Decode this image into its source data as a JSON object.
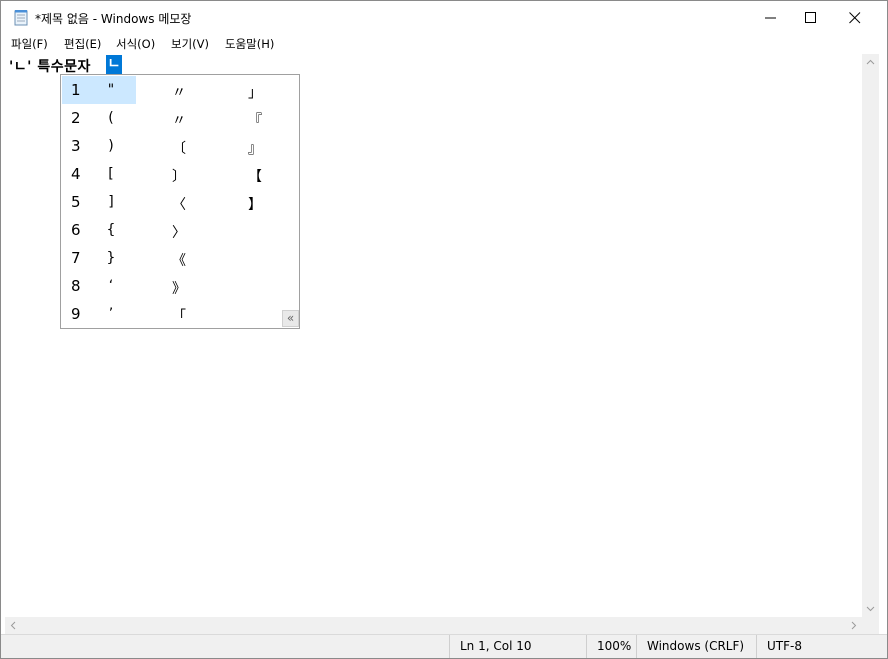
{
  "window": {
    "title": "*제목 없음 - Windows 메모장",
    "controls": {
      "minimize": "minimize-icon",
      "maximize": "maximize-icon",
      "close": "close-icon"
    }
  },
  "menu": {
    "items": [
      {
        "label": "파일(F)"
      },
      {
        "label": "편집(E)"
      },
      {
        "label": "서식(O)"
      },
      {
        "label": "보기(V)"
      },
      {
        "label": "도움말(H)"
      }
    ]
  },
  "editor": {
    "text": "'ㄴ' 특수문자 ",
    "composing_char": "ㄴ",
    "accent_color": "#0078d7"
  },
  "candidates": {
    "selected_index": 1,
    "selected_color": "#cce8ff",
    "rows": [
      {
        "num": "1",
        "c1": "\"",
        "c2": "〃",
        "c3": "」"
      },
      {
        "num": "2",
        "c1": "(",
        "c2": "〃",
        "c3": "『"
      },
      {
        "num": "3",
        "c1": ")",
        "c2": "〔",
        "c3": "』"
      },
      {
        "num": "4",
        "c1": "[",
        "c2": "〕",
        "c3": "【"
      },
      {
        "num": "5",
        "c1": "]",
        "c2": "〈",
        "c3": "】"
      },
      {
        "num": "6",
        "c1": "{",
        "c2": "〉",
        "c3": ""
      },
      {
        "num": "7",
        "c1": "}",
        "c2": "《",
        "c3": ""
      },
      {
        "num": "8",
        "c1": "‘",
        "c2": "》",
        "c3": ""
      },
      {
        "num": "9",
        "c1": "’",
        "c2": "「",
        "c3": ""
      }
    ],
    "expand_label": "«"
  },
  "status": {
    "position": "Ln 1, Col 10",
    "zoom": "100%",
    "line_ending": "Windows (CRLF)",
    "encoding": "UTF-8"
  }
}
